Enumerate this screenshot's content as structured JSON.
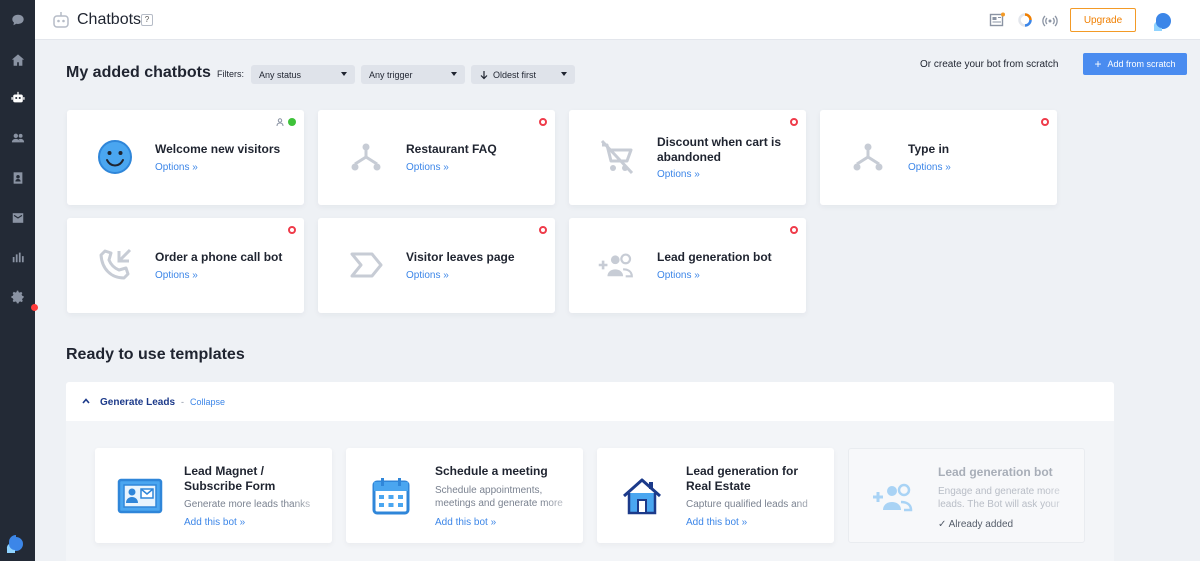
{
  "header": {
    "title": "Chatbots",
    "help": "?",
    "upgrade_label": "Upgrade"
  },
  "added": {
    "heading": "My added chatbots",
    "filters_label": "Filters:",
    "filters": [
      "Any status",
      "Any trigger",
      "Oldest first"
    ],
    "scratch_label": "Or create your bot from scratch",
    "add_label": "Add from scratch",
    "bots": [
      {
        "title": "Welcome new visitors",
        "options": "Options »",
        "status": "active",
        "icon": "smiley-icon"
      },
      {
        "title": "Restaurant FAQ",
        "options": "Options »",
        "status": "inactive",
        "icon": "flow-icon"
      },
      {
        "title": "Discount when cart is abandoned",
        "options": "Options »",
        "status": "inactive",
        "icon": "cart-off-icon"
      },
      {
        "title": "Type in",
        "options": "Options »",
        "status": "inactive",
        "icon": "flow-icon"
      },
      {
        "title": "Order a phone call bot",
        "options": "Options »",
        "status": "inactive",
        "icon": "phone-callback-icon"
      },
      {
        "title": "Visitor leaves page",
        "options": "Options »",
        "status": "inactive",
        "icon": "exit-arrow-icon"
      },
      {
        "title": "Lead generation bot",
        "options": "Options »",
        "status": "inactive",
        "icon": "add-users-icon"
      }
    ]
  },
  "templates": {
    "heading": "Ready to use templates",
    "group_title": "Generate Leads",
    "group_dash": "-",
    "collapse_label": "Collapse",
    "items": [
      {
        "title": "Lead Magnet / Subscribe Form",
        "desc": "Generate more leads thanks",
        "add": "Add this bot »",
        "icon": "subscribe-form-icon"
      },
      {
        "title": "Schedule a meeting",
        "desc": "Schedule appointments, meetings and generate more",
        "add": "Add this bot »",
        "icon": "calendar-icon"
      },
      {
        "title": "Lead generation for Real Estate",
        "desc": "Capture qualified leads and",
        "add": "Add this bot »",
        "icon": "house-icon"
      },
      {
        "title": "Lead generation bot",
        "desc": "Engage and generate more leads. The Bot will ask your",
        "add": "✓ Already added",
        "icon": "add-users-icon"
      }
    ]
  },
  "colors": {
    "accent": "#4a8cf0",
    "upgrade": "#f07f00",
    "active": "#3ec23a",
    "inactive": "#ef3b4a",
    "sidebar": "#232a36"
  }
}
